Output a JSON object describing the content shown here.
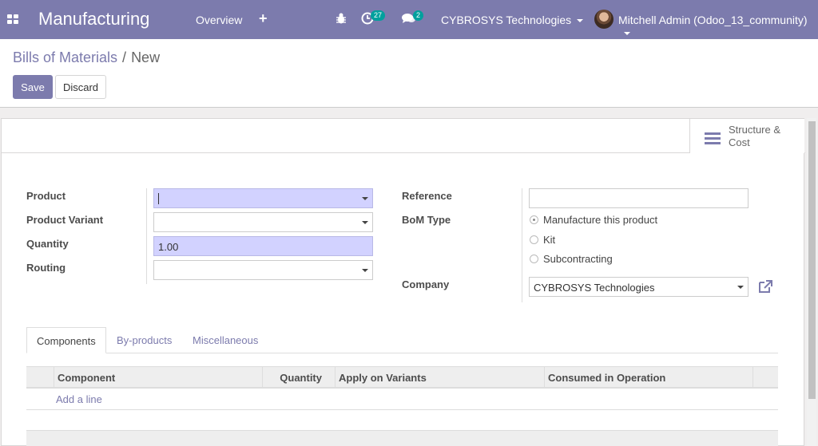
{
  "navbar": {
    "app_title": "Manufacturing",
    "menu_overview": "Overview",
    "menu_plus": "+",
    "activity_count": "27",
    "message_count": "2",
    "company": "CYBROSYS Technologies",
    "user": "Mitchell Admin (Odoo_13_community)",
    "color": "#7c7bad"
  },
  "breadcrumb": {
    "parent": "Bills of Materials",
    "separator": "/",
    "current": "New"
  },
  "buttons": {
    "save": "Save",
    "discard": "Discard"
  },
  "smart_button": {
    "line1": "Structure &",
    "line2": "Cost"
  },
  "form": {
    "product_label": "Product",
    "product_value": "",
    "variant_label": "Product Variant",
    "variant_value": "",
    "quantity_label": "Quantity",
    "quantity_value": "1.00",
    "routing_label": "Routing",
    "routing_value": "",
    "reference_label": "Reference",
    "reference_value": "",
    "bom_type_label": "BoM Type",
    "bom_type_options": [
      "Manufacture this product",
      "Kit",
      "Subcontracting"
    ],
    "bom_type_selected": "Manufacture this product",
    "company_label": "Company",
    "company_value": "CYBROSYS Technologies"
  },
  "tabs": [
    "Components",
    "By-products",
    "Miscellaneous"
  ],
  "table": {
    "columns": [
      "Component",
      "Quantity",
      "Apply on Variants",
      "Consumed in Operation"
    ],
    "add_line": "Add a line"
  }
}
